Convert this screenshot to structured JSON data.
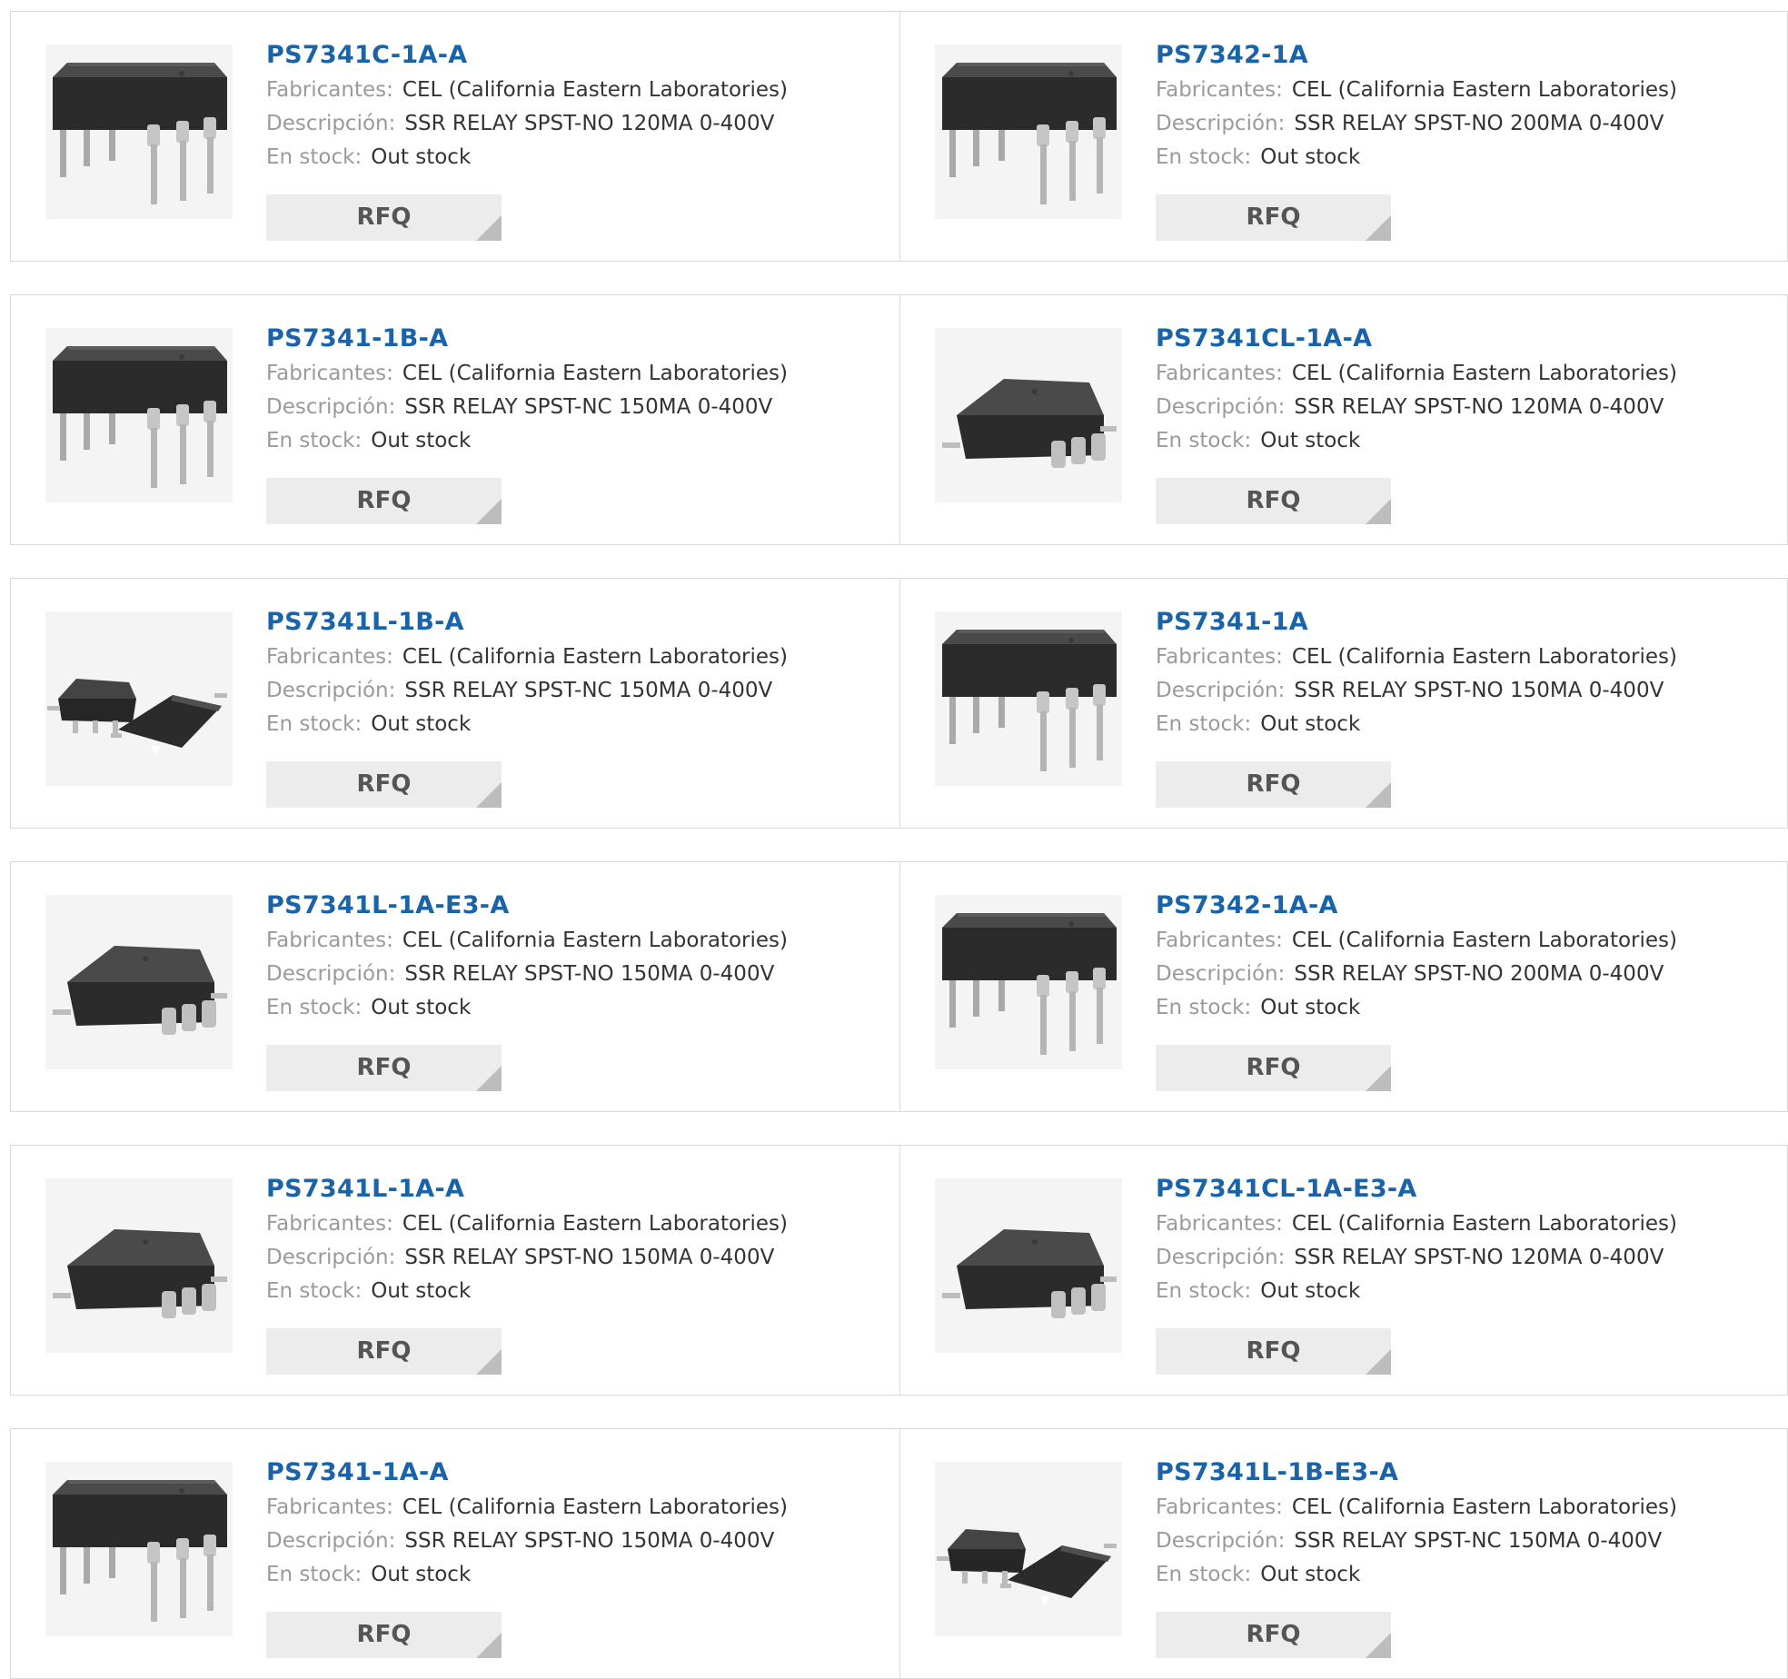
{
  "labels": {
    "manufacturer": "Fabricantes:",
    "description": "Descripción:",
    "stock": "En stock:",
    "rfq": "RFQ"
  },
  "colors": {
    "part_number": "#1a63a8",
    "label": "#9a9a9a",
    "value": "#333333",
    "rfq_bg": "#ececec",
    "border": "#d9d9d9"
  },
  "products": [
    {
      "part_number": "PS7341C-1A-A",
      "manufacturer": "CEL (California Eastern Laboratories)",
      "description": "SSR RELAY SPST-NO 120MA 0-400V",
      "stock": "Out stock",
      "package": "dip"
    },
    {
      "part_number": "PS7342-1A",
      "manufacturer": "CEL (California Eastern Laboratories)",
      "description": "SSR RELAY SPST-NO 200MA 0-400V",
      "stock": "Out stock",
      "package": "dip"
    },
    {
      "part_number": "PS7341-1B-A",
      "manufacturer": "CEL (California Eastern Laboratories)",
      "description": "SSR RELAY SPST-NC 150MA 0-400V",
      "stock": "Out stock",
      "package": "dip"
    },
    {
      "part_number": "PS7341CL-1A-A",
      "manufacturer": "CEL (California Eastern Laboratories)",
      "description": "SSR RELAY SPST-NO 120MA 0-400V",
      "stock": "Out stock",
      "package": "smd"
    },
    {
      "part_number": "PS7341L-1B-A",
      "manufacturer": "CEL (California Eastern Laboratories)",
      "description": "SSR RELAY SPST-NC 150MA 0-400V",
      "stock": "Out stock",
      "package": "smd-pair"
    },
    {
      "part_number": "PS7341-1A",
      "manufacturer": "CEL (California Eastern Laboratories)",
      "description": "SSR RELAY SPST-NO 150MA 0-400V",
      "stock": "Out stock",
      "package": "dip"
    },
    {
      "part_number": "PS7341L-1A-E3-A",
      "manufacturer": "CEL (California Eastern Laboratories)",
      "description": "SSR RELAY SPST-NO 150MA 0-400V",
      "stock": "Out stock",
      "package": "smd"
    },
    {
      "part_number": "PS7342-1A-A",
      "manufacturer": "CEL (California Eastern Laboratories)",
      "description": "SSR RELAY SPST-NO 200MA 0-400V",
      "stock": "Out stock",
      "package": "dip"
    },
    {
      "part_number": "PS7341L-1A-A",
      "manufacturer": "CEL (California Eastern Laboratories)",
      "description": "SSR RELAY SPST-NO 150MA 0-400V",
      "stock": "Out stock",
      "package": "smd"
    },
    {
      "part_number": "PS7341CL-1A-E3-A",
      "manufacturer": "CEL (California Eastern Laboratories)",
      "description": "SSR RELAY SPST-NO 120MA 0-400V",
      "stock": "Out stock",
      "package": "smd"
    },
    {
      "part_number": "PS7341-1A-A",
      "manufacturer": "CEL (California Eastern Laboratories)",
      "description": "SSR RELAY SPST-NO 150MA 0-400V",
      "stock": "Out stock",
      "package": "dip"
    },
    {
      "part_number": "PS7341L-1B-E3-A",
      "manufacturer": "CEL (California Eastern Laboratories)",
      "description": "SSR RELAY SPST-NC 150MA 0-400V",
      "stock": "Out stock",
      "package": "smd-pair"
    }
  ]
}
